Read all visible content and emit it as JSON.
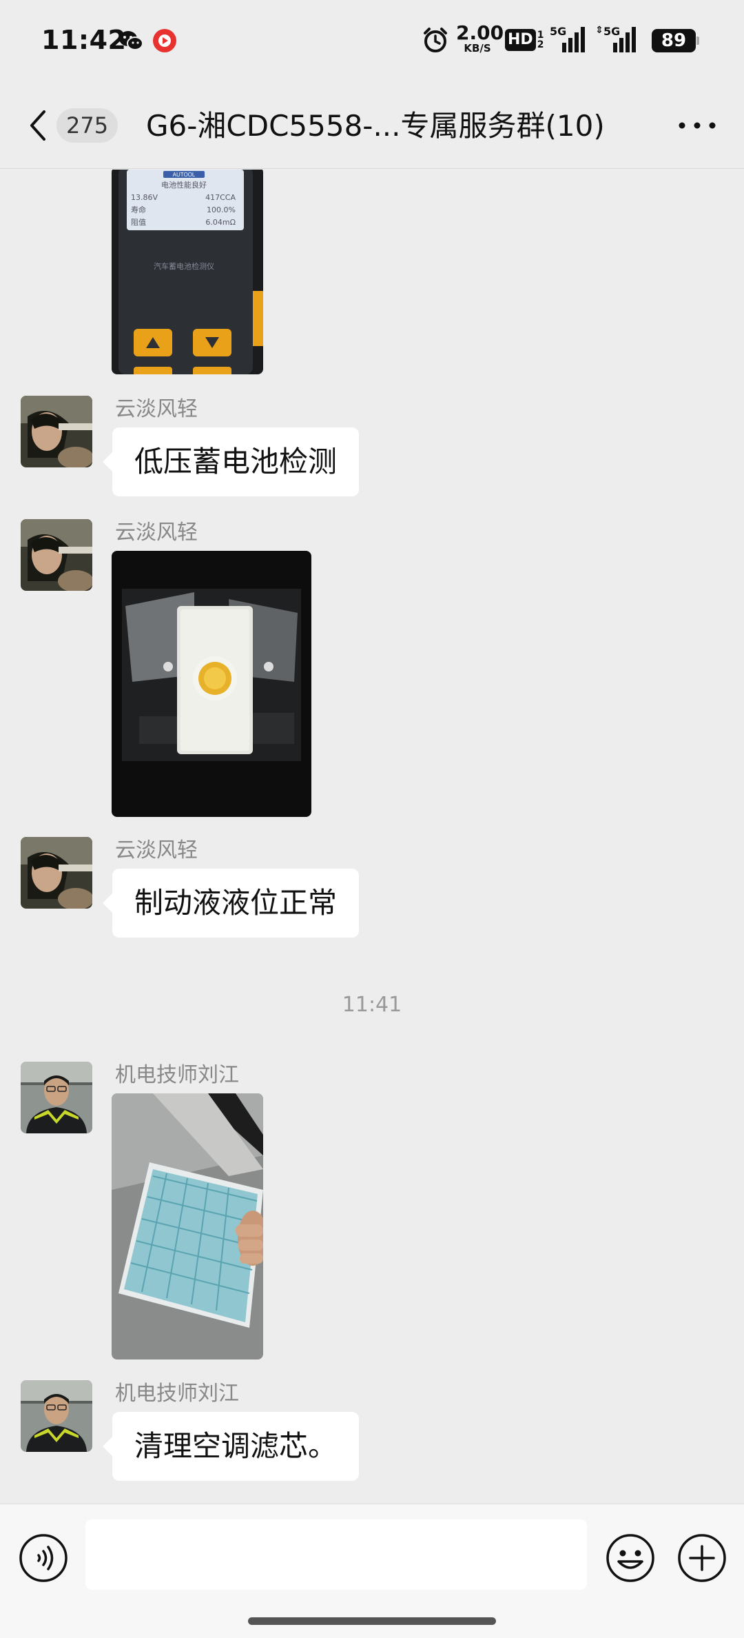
{
  "status_bar": {
    "time": "11:42",
    "net_speed": "2.00",
    "net_unit": "KB/S",
    "hd_label": "HD",
    "sim1_label": "5G",
    "sim2_label": "5G",
    "battery": "89"
  },
  "header": {
    "unread_count": "275",
    "title": "G6-湘CDC5558-...专属服务群(10)"
  },
  "messages": [
    {
      "type": "image",
      "sender": "",
      "description": "battery tester photo"
    },
    {
      "type": "text",
      "sender": "云淡风轻",
      "text": "低压蓄电池检测"
    },
    {
      "type": "image",
      "sender": "云淡风轻",
      "description": "brake fluid reservoir photo"
    },
    {
      "type": "text",
      "sender": "云淡风轻",
      "text": "制动液液位正常"
    },
    {
      "type": "timestamp",
      "text": "11:41"
    },
    {
      "type": "image",
      "sender": "机电技师刘江",
      "description": "cabin air filter photo"
    },
    {
      "type": "text",
      "sender": "机电技师刘江",
      "text": "清理空调滤芯。"
    }
  ],
  "photo_texts": {
    "tester_brand": "AUTOOL",
    "tester_screen_title": "电池性能良好",
    "tester_voltage": "13.86V",
    "tester_cca": "417CCA",
    "tester_life_label": "寿命",
    "tester_life": "100.0%",
    "tester_res_label": "阻值",
    "tester_res": "6.04mΩ",
    "tester_caption": "汽车蓄电池检测仪"
  },
  "input_bar": {
    "placeholder": ""
  },
  "icons": {
    "back": "chevron-left-icon",
    "more": "more-dots-icon",
    "voice": "voice-icon",
    "emoji": "emoji-icon",
    "plus": "plus-icon",
    "alarm": "alarm-icon",
    "wechat": "wechat-icon",
    "video": "video-app-icon"
  },
  "colors": {
    "background": "#ededed",
    "bubble": "#ffffff",
    "sender_text": "#888888"
  }
}
